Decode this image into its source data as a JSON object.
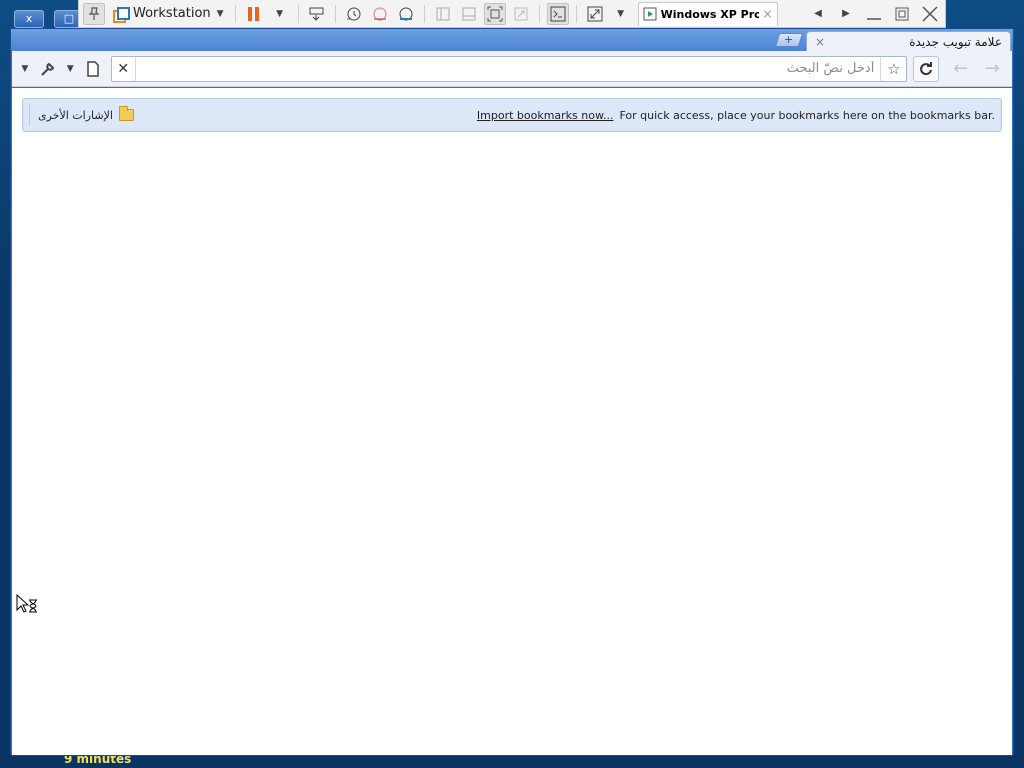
{
  "desktop": {
    "left_controls": [
      "x",
      "□"
    ],
    "footer_text": "9 minutes"
  },
  "vmware": {
    "brand": "Workstation",
    "vm_tab_label": "Windows XP Pro...",
    "vm_tab_close": "×"
  },
  "chrome": {
    "tab_title": "علامة تبويب جديدة",
    "tab_close": "×",
    "new_tab": "+",
    "omnibox_placeholder": "أدخل نصّ البحث",
    "omnibox_value": "",
    "bookmarks_bar": {
      "other_bookmarks": "الإشارات الأخرى",
      "import_link": "Import bookmarks now...",
      "message": "For quick access, place your bookmarks here on the bookmarks bar."
    }
  }
}
